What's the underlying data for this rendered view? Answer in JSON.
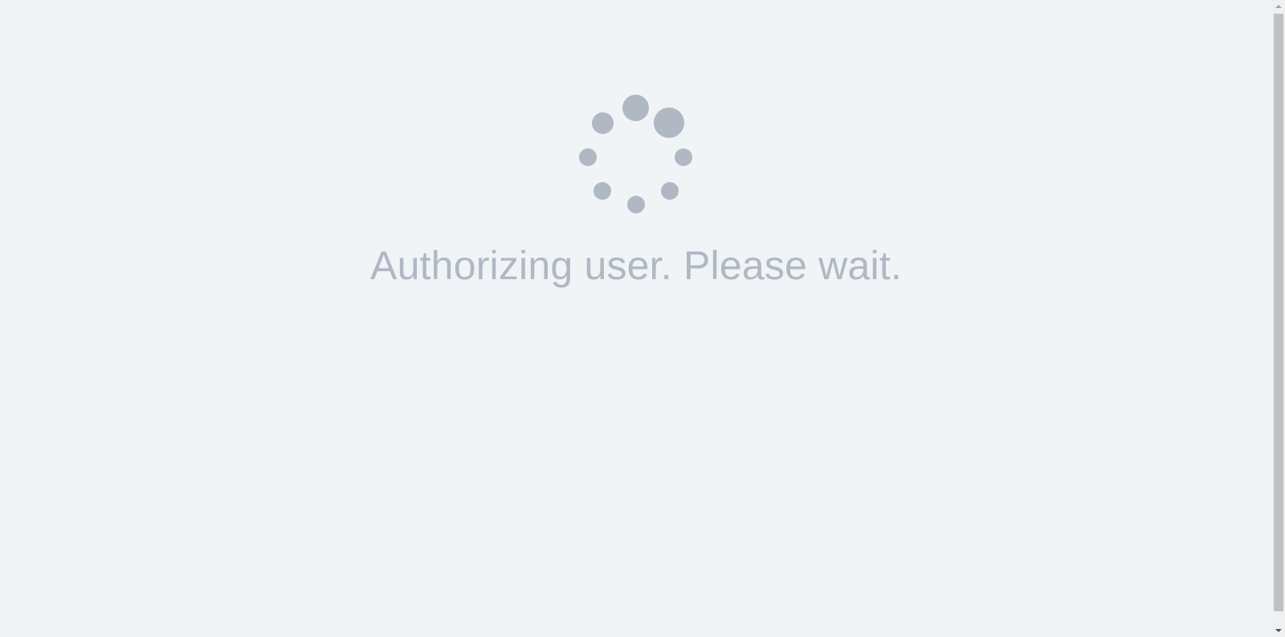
{
  "loading": {
    "message": "Authorizing user. Please wait."
  },
  "colors": {
    "background": "#f0f4f7",
    "spinner_dot": "#b0b8c3",
    "message_text": "#b0b8c3",
    "scrollbar_thumb": "#c1c1c1"
  },
  "icons": {
    "spinner": "loading-spinner-icon",
    "scroll_up": "scroll-up-arrow-icon",
    "scroll_down": "scroll-down-arrow-icon"
  }
}
